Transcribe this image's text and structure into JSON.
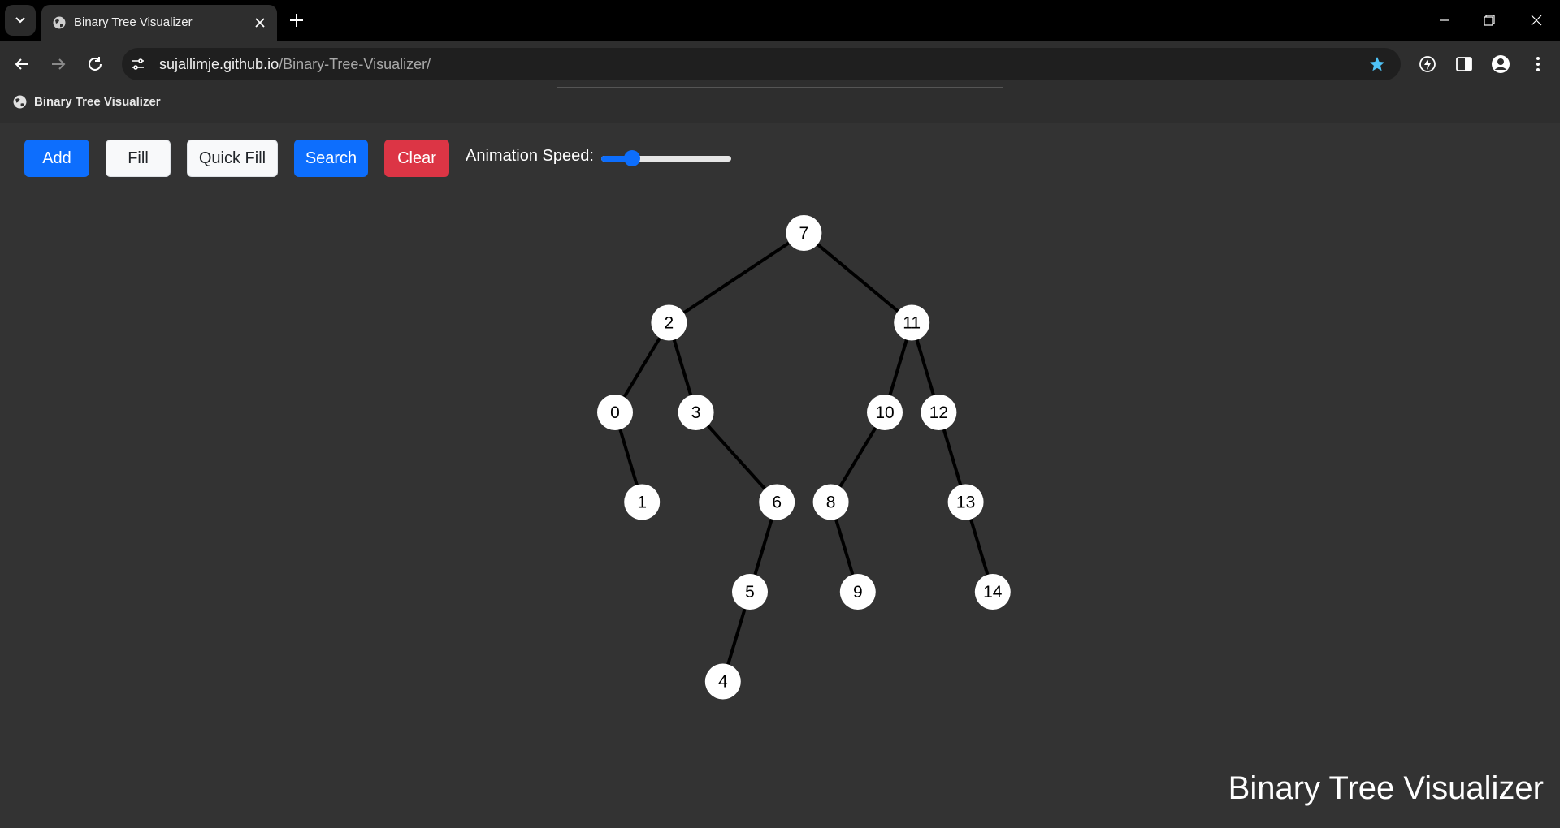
{
  "browser": {
    "tab_title": "Binary Tree Visualizer",
    "url_host": "sujallimje.github.io",
    "url_path": "/Binary-Tree-Visualizer/",
    "bookmark_label": "Binary Tree Visualizer"
  },
  "controls": {
    "add_label": "Add",
    "fill_label": "Fill",
    "quick_fill_label": "Quick Fill",
    "search_label": "Search",
    "clear_label": "Clear",
    "speed_label": "Animation Speed:",
    "speed_value": 0.2
  },
  "tree": {
    "nodes": [
      {
        "value": "7",
        "depth": 0,
        "slot": 7
      },
      {
        "value": "2",
        "depth": 1,
        "slot": 2
      },
      {
        "value": "11",
        "depth": 1,
        "slot": 11
      },
      {
        "value": "0",
        "depth": 2,
        "slot": 0
      },
      {
        "value": "3",
        "depth": 2,
        "slot": 3
      },
      {
        "value": "10",
        "depth": 2,
        "slot": 10
      },
      {
        "value": "12",
        "depth": 2,
        "slot": 12
      },
      {
        "value": "1",
        "depth": 3,
        "slot": 1
      },
      {
        "value": "6",
        "depth": 3,
        "slot": 6
      },
      {
        "value": "8",
        "depth": 3,
        "slot": 8
      },
      {
        "value": "13",
        "depth": 3,
        "slot": 13
      },
      {
        "value": "5",
        "depth": 4,
        "slot": 5
      },
      {
        "value": "9",
        "depth": 4,
        "slot": 9
      },
      {
        "value": "14",
        "depth": 4,
        "slot": 14
      },
      {
        "value": "4",
        "depth": 5,
        "slot": 4
      }
    ],
    "edges": [
      [
        "7",
        "2"
      ],
      [
        "7",
        "11"
      ],
      [
        "2",
        "0"
      ],
      [
        "2",
        "3"
      ],
      [
        "11",
        "10"
      ],
      [
        "11",
        "12"
      ],
      [
        "0",
        "1"
      ],
      [
        "3",
        "6"
      ],
      [
        "10",
        "8"
      ],
      [
        "12",
        "13"
      ],
      [
        "6",
        "5"
      ],
      [
        "8",
        "9"
      ],
      [
        "13",
        "14"
      ],
      [
        "5",
        "4"
      ]
    ]
  },
  "footer": {
    "title": "Binary Tree Visualizer"
  },
  "colors": {
    "accent": "#0d6efd",
    "danger": "#dc3545",
    "page_bg": "#333333",
    "node_fill": "#ffffff",
    "edge": "#000000"
  }
}
